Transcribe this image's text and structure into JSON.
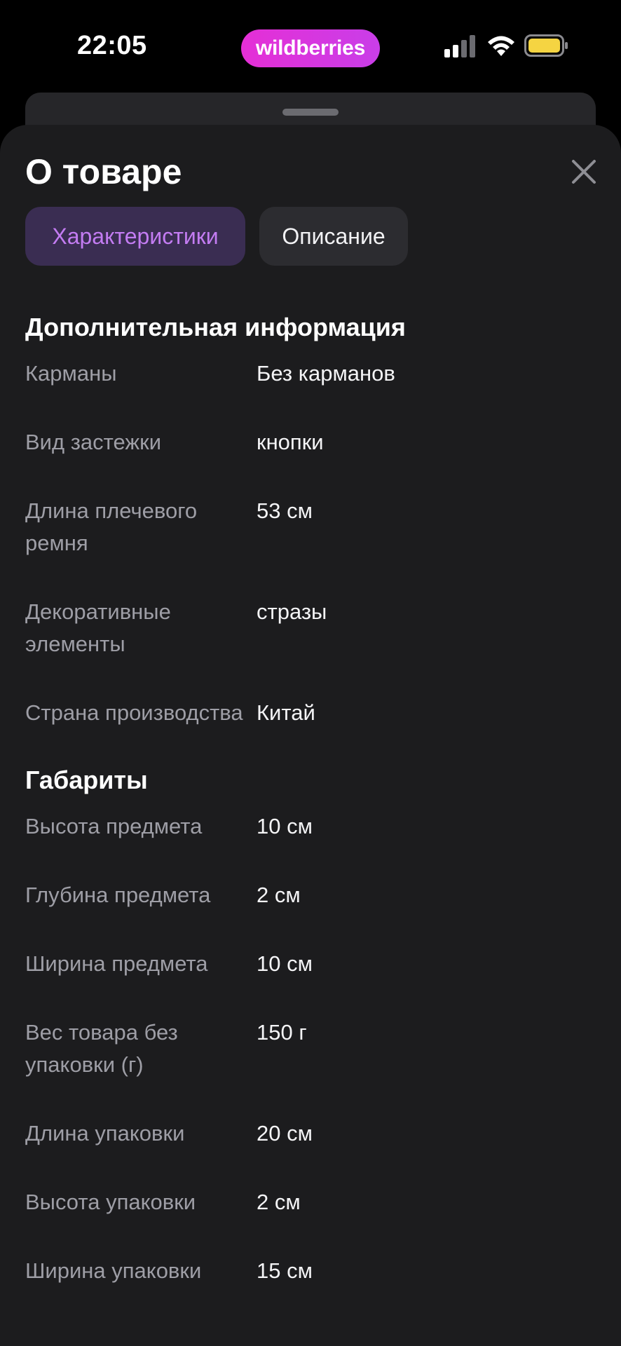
{
  "status_bar": {
    "time": "22:05",
    "brand": "wildberries",
    "icons": [
      "cellular-signal-icon",
      "wifi-icon",
      "battery-icon"
    ],
    "battery_color": "#f5d442"
  },
  "sheet": {
    "title": "О товаре",
    "close_icon": "close-icon",
    "tabs": [
      {
        "label": "Характеристики",
        "active": true
      },
      {
        "label": "Описание",
        "active": false
      }
    ]
  },
  "sections": [
    {
      "title": "Дополнительная информация",
      "rows": [
        {
          "label": "Карманы",
          "value": "Без карманов"
        },
        {
          "label": "Вид застежки",
          "value": "кнопки"
        },
        {
          "label": "Длина плечевого ремня",
          "value": "53 см"
        },
        {
          "label": "Декоративные элементы",
          "value": "стразы"
        },
        {
          "label": "Страна производства",
          "value": "Китай"
        }
      ]
    },
    {
      "title": "Габариты",
      "rows": [
        {
          "label": "Высота предмета",
          "value": "10 см"
        },
        {
          "label": "Глубина предмета",
          "value": "2 см"
        },
        {
          "label": "Ширина предмета",
          "value": "10 см"
        },
        {
          "label": "Вес товара без упаковки (г)",
          "value": "150 г"
        },
        {
          "label": "Длина упаковки",
          "value": "20 см"
        },
        {
          "label": "Высота упаковки",
          "value": "2 см"
        },
        {
          "label": "Ширина упаковки",
          "value": "15 см"
        }
      ]
    }
  ],
  "colors": {
    "brand": "#e52fd6",
    "accent_tab_text": "#c37cf2",
    "accent_tab_bg": "#3a2d52",
    "sheet_bg": "#1c1c1e"
  }
}
